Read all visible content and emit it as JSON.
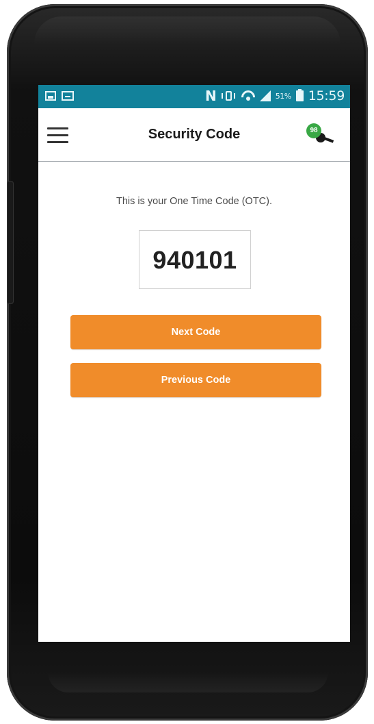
{
  "status_bar": {
    "battery_percent": "51%",
    "time": "15:59",
    "color": "#12829b"
  },
  "app_bar": {
    "title": "Security Code",
    "badge_count": "98"
  },
  "main": {
    "otc_label": "This is your One Time Code (OTC).",
    "code": "940101",
    "next_button_label": "Next Code",
    "previous_button_label": "Previous Code",
    "accent_color": "#f08c2a"
  },
  "icons": {
    "menu": "hamburger-menu-icon",
    "badge": "key-badge-icon",
    "status": [
      "image-icon",
      "mail-icon",
      "nfc-icon",
      "vibrate-icon",
      "wifi-icon",
      "signal-icon",
      "battery-icon"
    ]
  }
}
